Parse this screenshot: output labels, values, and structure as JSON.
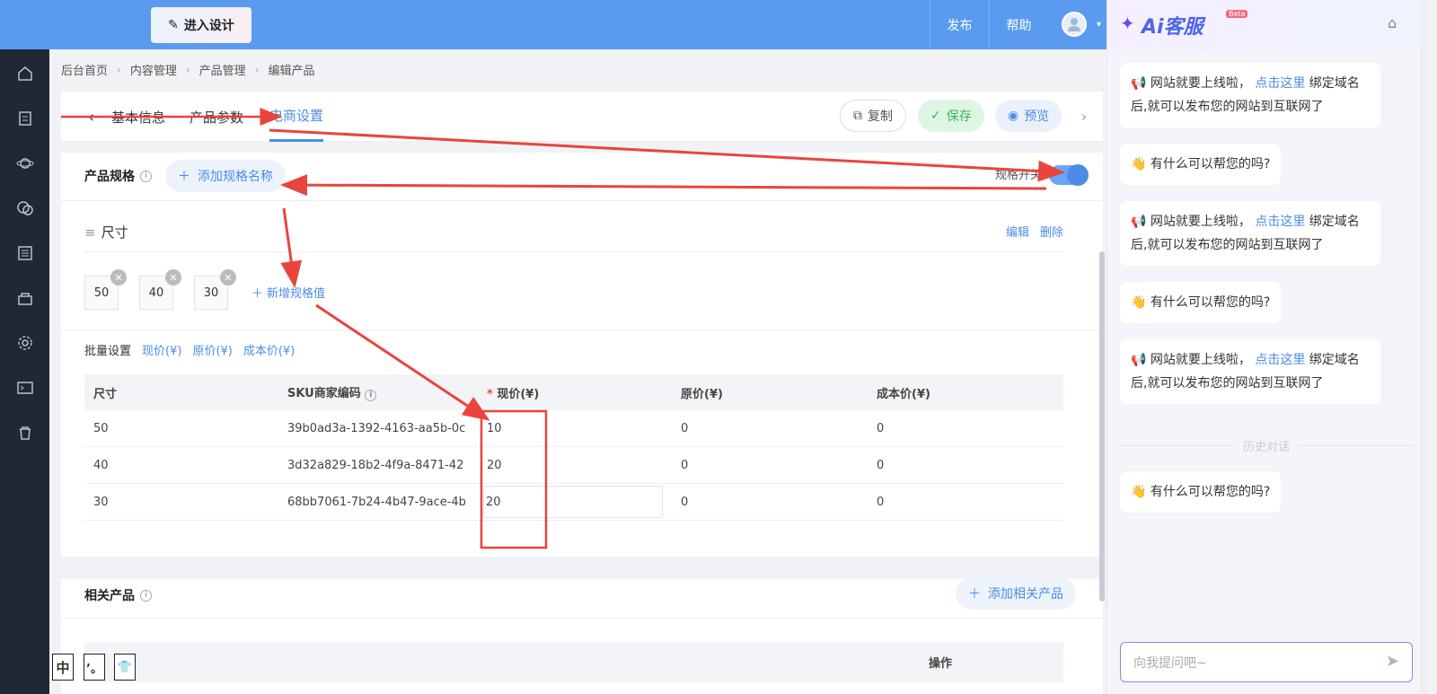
{
  "topbar": {
    "design_label": "进入设计",
    "publish_label": "发布",
    "help_label": "帮助"
  },
  "breadcrumb": [
    "后台首页",
    "内容管理",
    "产品管理",
    "编辑产品"
  ],
  "tabs": [
    "基本信息",
    "产品参数",
    "电商设置"
  ],
  "actions": {
    "copy": "复制",
    "save": "保存",
    "preview": "预览"
  },
  "spec": {
    "title": "产品规格",
    "add_spec_label": "添加规格名称",
    "toggle_label": "规格开关",
    "group_name": "尺寸",
    "edit_label": "编辑",
    "delete_label": "删除",
    "values": [
      "50",
      "40",
      "30"
    ],
    "add_value_label": "新增规格值"
  },
  "batch": {
    "label": "批量设置",
    "options": [
      "现价(¥)",
      "原价(¥)",
      "成本价(¥)"
    ]
  },
  "sku_table": {
    "headers": [
      "尺寸",
      "SKU商家编码",
      "现价(¥)",
      "原价(¥)",
      "成本价(¥)"
    ],
    "required_mark": "*",
    "rows": [
      {
        "size": "50",
        "sku": "39b0ad3a-1392-4163-aa5b-0c",
        "price": "10",
        "orig": "0",
        "cost": "0"
      },
      {
        "size": "40",
        "sku": "3d32a829-18b2-4f9a-8471-42",
        "price": "20",
        "orig": "0",
        "cost": "0"
      },
      {
        "size": "30",
        "sku": "68bb7061-7b24-4b47-9ace-4b",
        "price": "20",
        "orig": "0",
        "cost": "0"
      }
    ]
  },
  "related": {
    "title": "相关产品",
    "add_label": "添加相关产品",
    "col_action": "操作"
  },
  "ai": {
    "title": "Ai客服",
    "badge": "Beta",
    "msg_pre": "网站就要上线啦，",
    "msg_link": "点击这里",
    "msg_post": "绑定域名后,就可以发布您的网站到互联网了",
    "help_msg": "有什么可以帮您的吗?",
    "history_label": "历史对话",
    "input_placeholder": "向我提问吧~"
  },
  "ime": [
    "中",
    "’。",
    "👕"
  ],
  "colors": {
    "accent": "#4a8ce8",
    "topbar": "#5a9bf0",
    "sidebar": "#202833",
    "annotation": "#e8453c"
  }
}
